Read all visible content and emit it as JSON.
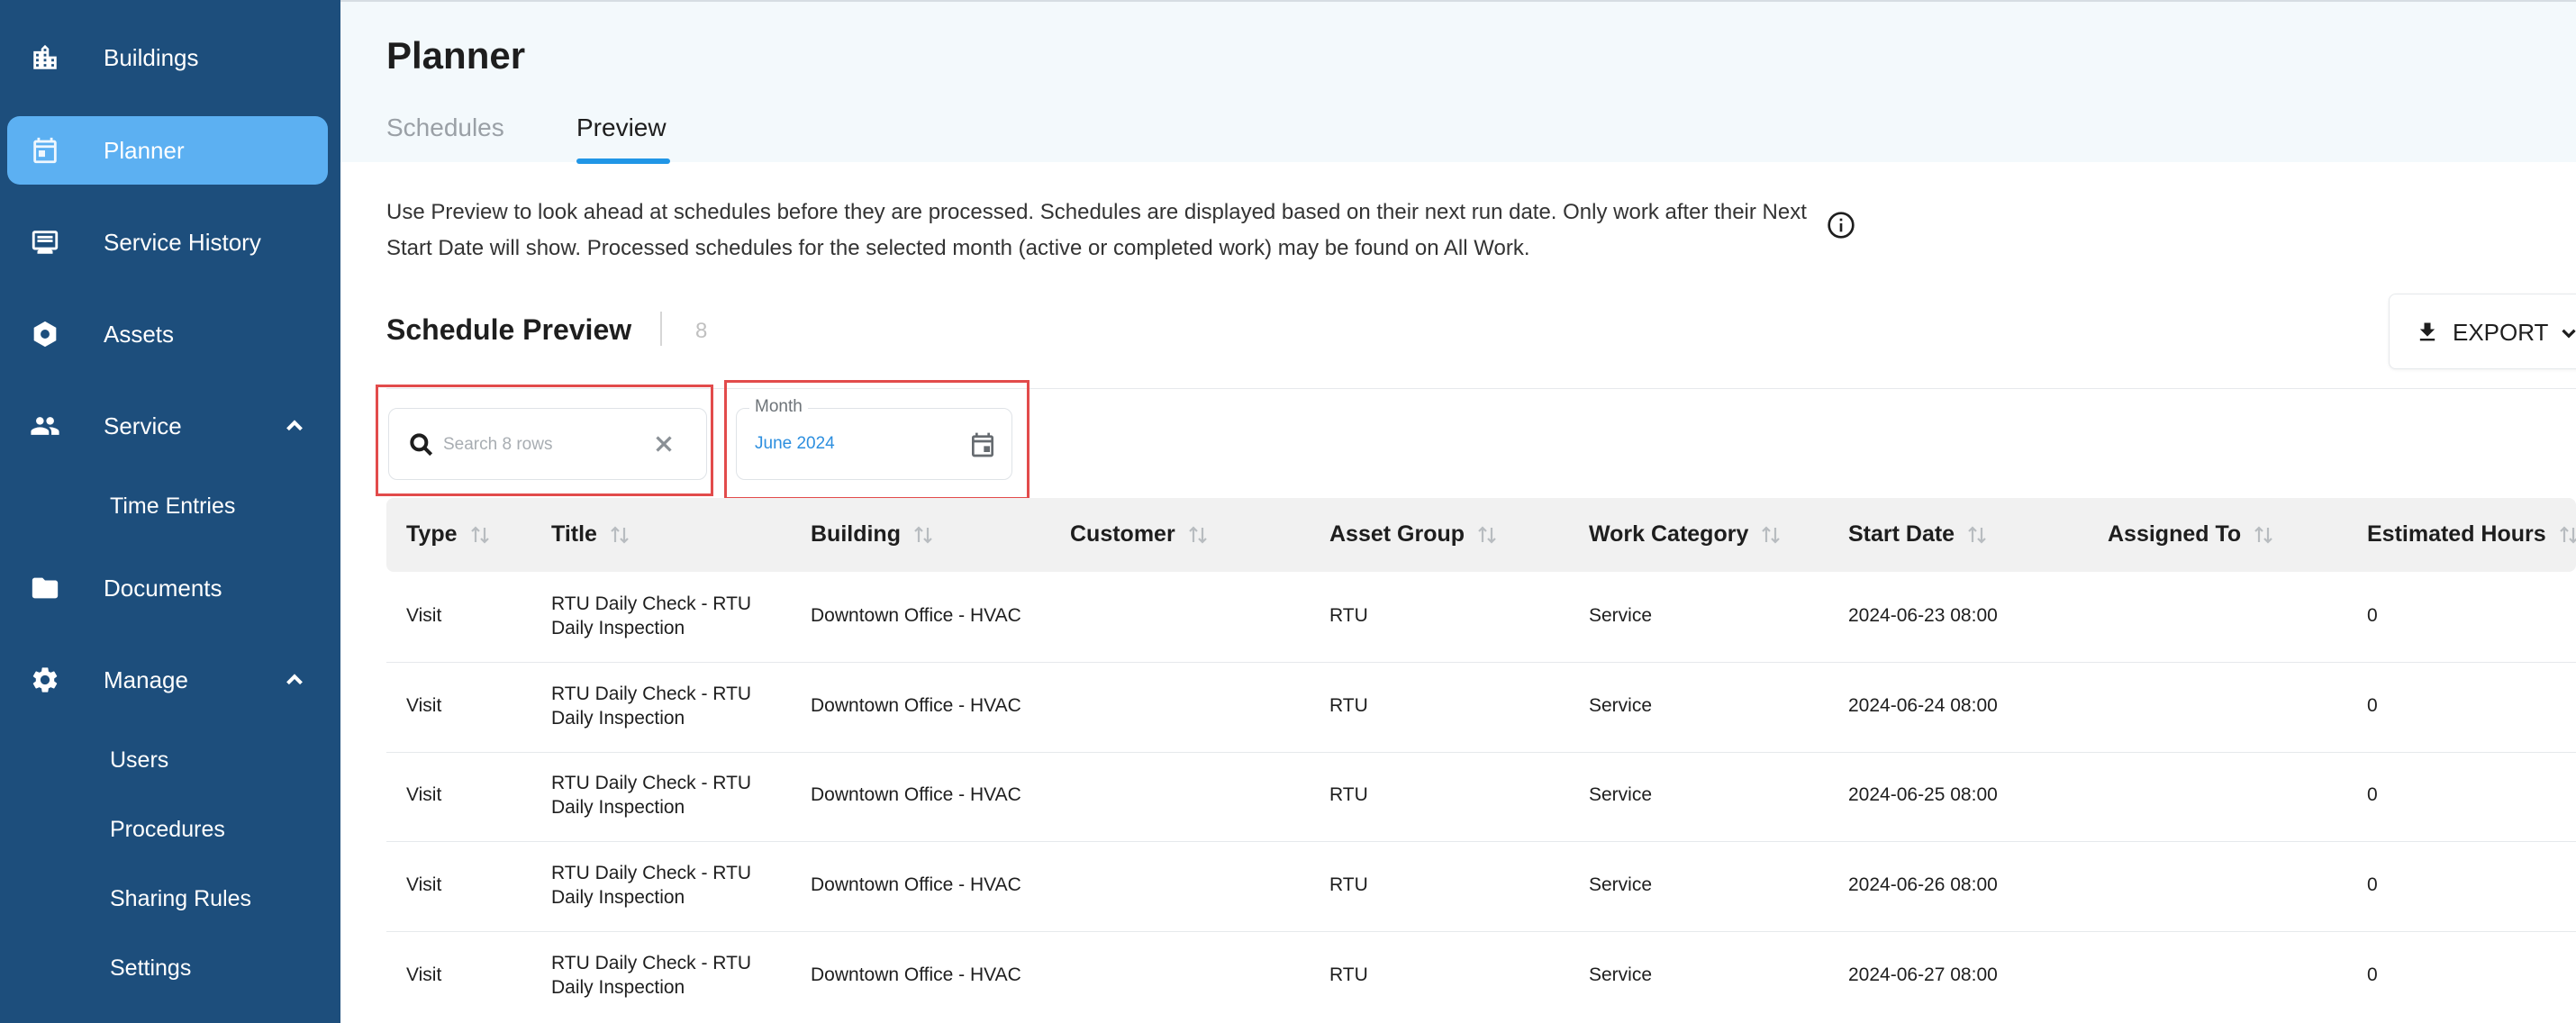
{
  "sidebar": {
    "items": [
      {
        "label": "Buildings",
        "icon": "building-icon"
      },
      {
        "label": "Planner",
        "icon": "calendar-icon",
        "active": true
      },
      {
        "label": "Service History",
        "icon": "list-icon"
      },
      {
        "label": "Assets",
        "icon": "hexagon-icon"
      },
      {
        "label": "Service",
        "icon": "people-icon",
        "expanded": true
      },
      {
        "label": "Documents",
        "icon": "folder-icon"
      },
      {
        "label": "Manage",
        "icon": "gear-icon",
        "expanded": true
      }
    ],
    "service_sub": [
      "Time Entries"
    ],
    "manage_sub": [
      "Users",
      "Procedures",
      "Sharing Rules",
      "Settings"
    ]
  },
  "header": {
    "title": "Planner",
    "tabs": [
      {
        "label": "Schedules",
        "active": false
      },
      {
        "label": "Preview",
        "active": true
      }
    ]
  },
  "info": {
    "text": "Use Preview to look ahead at schedules before they are processed. Schedules are displayed based on their next run date. Only work after their Next Start Date will show. Processed schedules for the selected month (active or completed work) may be found on All Work."
  },
  "section": {
    "title": "Schedule Preview",
    "count": "8",
    "export_label": "EXPORT"
  },
  "search": {
    "placeholder": "Search 8 rows",
    "value": ""
  },
  "month": {
    "label": "Month",
    "value": "June 2024"
  },
  "table": {
    "columns": [
      "Type",
      "Title",
      "Building",
      "Customer",
      "Asset Group",
      "Work Category",
      "Start Date",
      "Assigned To",
      "Estimated Hours"
    ],
    "rows": [
      {
        "type": "Visit",
        "title_line1": "RTU Daily Check - RTU",
        "title_line2": "Daily Inspection",
        "building": "Downtown Office - HVAC",
        "customer": "",
        "asset_group": "RTU",
        "work_category": "Service",
        "start_date": "2024-06-23 08:00",
        "assigned_to": "",
        "estimated_hours": "0"
      },
      {
        "type": "Visit",
        "title_line1": "RTU Daily Check - RTU",
        "title_line2": "Daily Inspection",
        "building": "Downtown Office - HVAC",
        "customer": "",
        "asset_group": "RTU",
        "work_category": "Service",
        "start_date": "2024-06-24 08:00",
        "assigned_to": "",
        "estimated_hours": "0"
      },
      {
        "type": "Visit",
        "title_line1": "RTU Daily Check - RTU",
        "title_line2": "Daily Inspection",
        "building": "Downtown Office - HVAC",
        "customer": "",
        "asset_group": "RTU",
        "work_category": "Service",
        "start_date": "2024-06-25 08:00",
        "assigned_to": "",
        "estimated_hours": "0"
      },
      {
        "type": "Visit",
        "title_line1": "RTU Daily Check - RTU",
        "title_line2": "Daily Inspection",
        "building": "Downtown Office - HVAC",
        "customer": "",
        "asset_group": "RTU",
        "work_category": "Service",
        "start_date": "2024-06-26 08:00",
        "assigned_to": "",
        "estimated_hours": "0"
      },
      {
        "type": "Visit",
        "title_line1": "RTU Daily Check - RTU",
        "title_line2": "Daily Inspection",
        "building": "Downtown Office - HVAC",
        "customer": "",
        "asset_group": "RTU",
        "work_category": "Service",
        "start_date": "2024-06-27 08:00",
        "assigned_to": "",
        "estimated_hours": "0"
      }
    ]
  },
  "colors": {
    "sidebar_bg": "#1d4e7c",
    "active_nav": "#5cb0f2",
    "accent": "#2196e6",
    "highlight_box": "#e24b4b"
  }
}
